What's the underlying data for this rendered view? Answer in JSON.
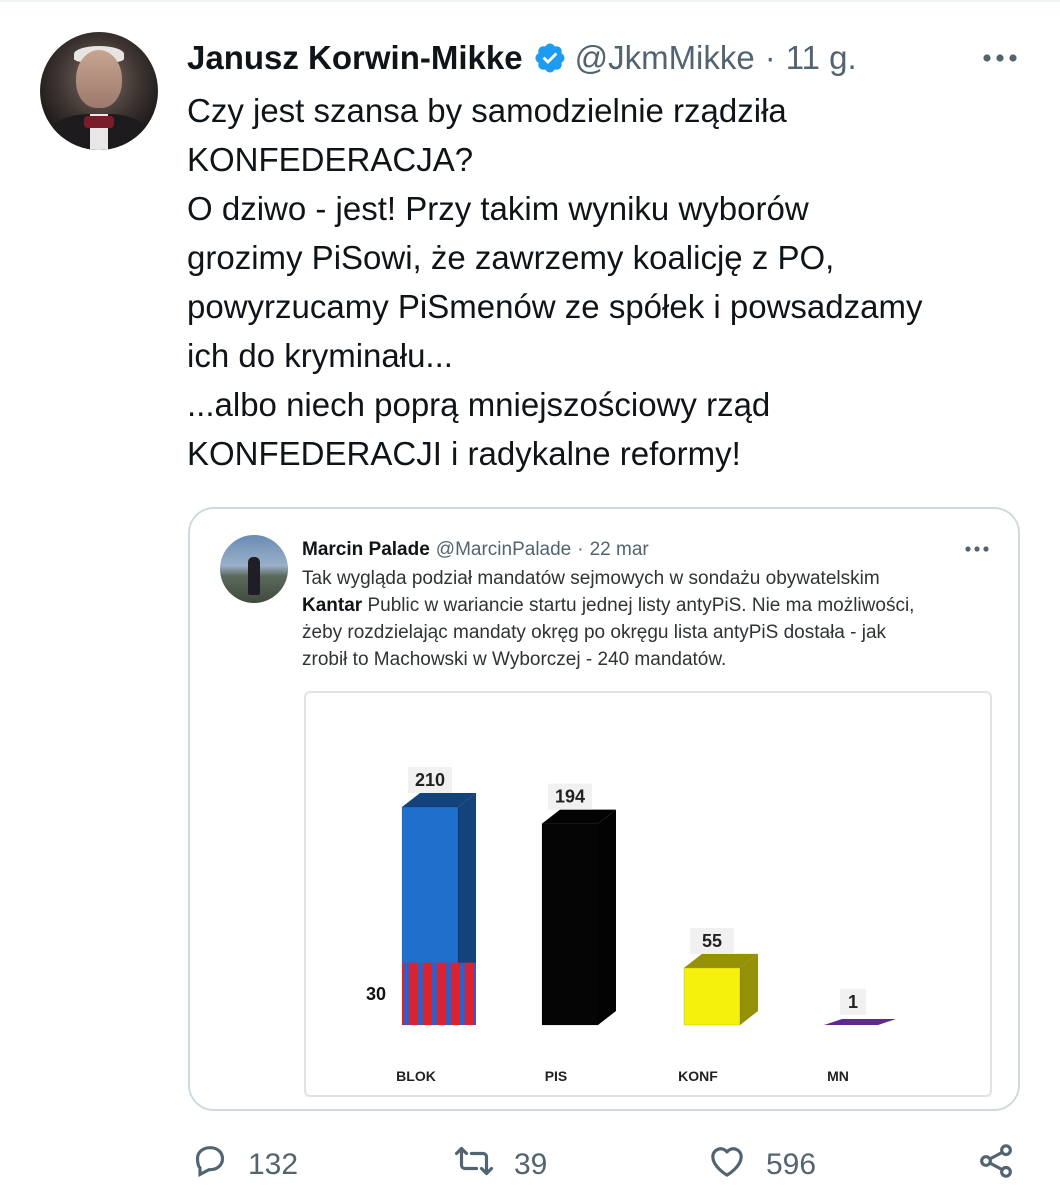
{
  "author": {
    "name": "Janusz Korwin-Mikke",
    "handle": "@JkmMikke",
    "separator": "·",
    "time": "11 g.",
    "verified": true
  },
  "tweet_lines": [
    "Czy jest szansa by samodzielnie rządziła",
    "KONFEDERACJA?",
    "O dziwo - jest! Przy takim wyniku wyborów",
    "grozimy PiSowi, że zawrzemy koalicję z PO,",
    "powyrzucamy PiSmenów ze spółek i powsadzamy",
    "ich do kryminału...",
    "...albo niech poprą mniejszościowy rząd",
    "KONFEDERACJI i radykalne reformy!"
  ],
  "quote": {
    "name": "Marcin Palade",
    "handle": "@MarcinPalade",
    "separator": "·",
    "date": "22 mar",
    "line1": "Tak wygląda podział mandatów sejmowych w sondażu obywatelskim",
    "line2_bold": "Kantar",
    "line2_rest": " Public w wariancie startu jednej listy antyPiS. Nie ma możliwości,",
    "line3": "żeby rozdzielając mandaty okręg po okręgu lista antyPiS dostała - jak",
    "line4": "zrobił to Machowski w Wyborczej - 240 mandatów."
  },
  "chart_data": {
    "type": "bar",
    "categories": [
      "BLOK",
      "PIS",
      "KONF",
      "MN"
    ],
    "values": [
      210,
      194,
      55,
      1
    ],
    "stacked_segment": {
      "category": "BLOK",
      "value": 30
    },
    "colors": {
      "BLOK": "#1f6fcc",
      "BLOK_segment": "#d62433",
      "PIS": "#050505",
      "KONF": "#f6f00d",
      "MN": "#5d2a91"
    },
    "ylim": [
      0,
      220
    ]
  },
  "actions": {
    "replies": "132",
    "retweets": "39",
    "likes": "596"
  },
  "icons": [
    "verified-badge-icon",
    "more-icon",
    "reply-icon",
    "retweet-icon",
    "like-icon",
    "share-icon"
  ],
  "colors": {
    "text": "#0f1419",
    "secondary": "#536471",
    "verified": "#1d9bf0",
    "border": "#cfd9de"
  }
}
